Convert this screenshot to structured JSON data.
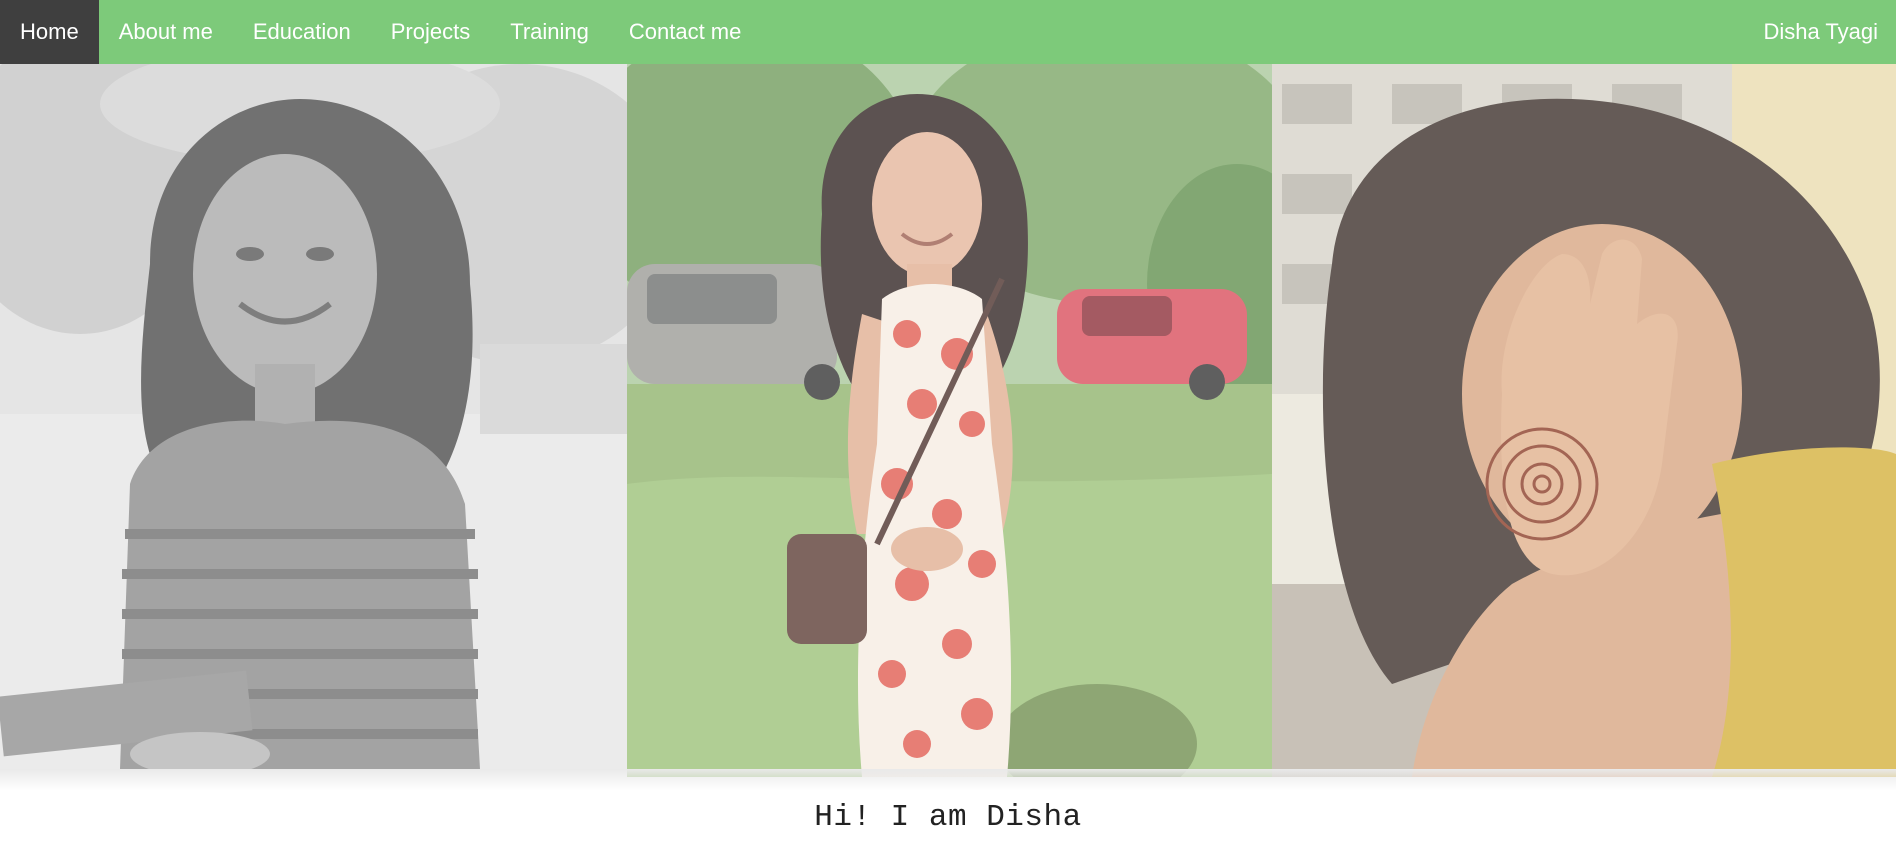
{
  "nav": {
    "items": [
      {
        "label": "Home",
        "active": true
      },
      {
        "label": "About me",
        "active": false
      },
      {
        "label": "Education",
        "active": false
      },
      {
        "label": "Projects",
        "active": false
      },
      {
        "label": "Training",
        "active": false
      },
      {
        "label": "Contact me",
        "active": false
      }
    ],
    "brand": "Disha Tyagi"
  },
  "hero": {
    "photos": [
      {
        "name": "portrait-grayscale-striped-top"
      },
      {
        "name": "portrait-floral-dress-garden"
      },
      {
        "name": "portrait-face-covered-henna-hand"
      }
    ]
  },
  "greeting": "Hi! I am Disha",
  "colors": {
    "nav_bg": "#7dca7a",
    "nav_active_bg": "#3f3f3f",
    "nav_text": "#ffffff",
    "greeting_text": "#222222"
  }
}
